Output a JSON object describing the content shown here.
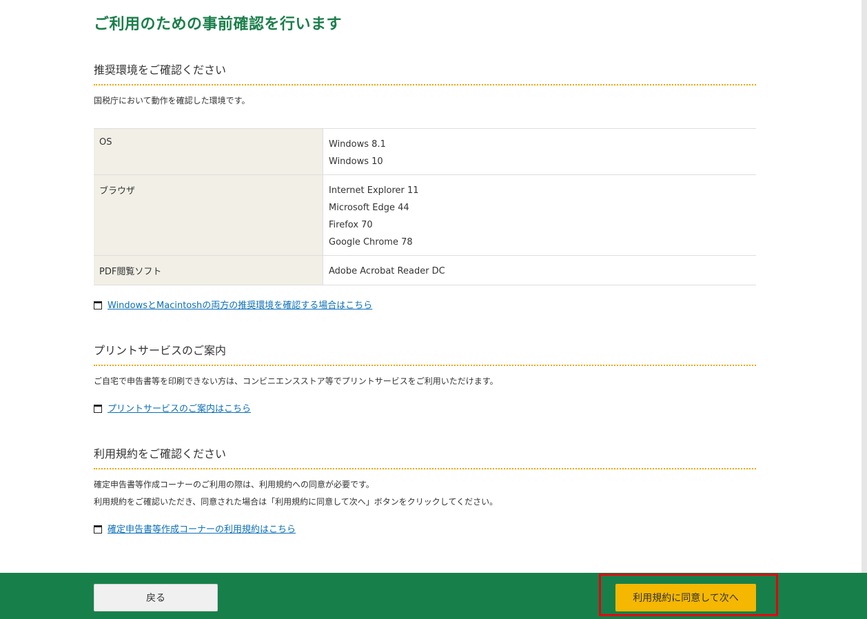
{
  "page_title": "ご利用のための事前確認を行います",
  "env_section": {
    "heading": "推奨環境をご確認ください",
    "description": "国税庁において動作を確認した環境です。",
    "rows": [
      {
        "label": "OS",
        "values": [
          "Windows 8.1",
          "Windows 10"
        ]
      },
      {
        "label": "ブラウザ",
        "values": [
          "Internet Explorer 11",
          "Microsoft Edge 44",
          "Firefox 70",
          "Google Chrome 78"
        ]
      },
      {
        "label": "PDF閲覧ソフト",
        "values": [
          "Adobe Acrobat Reader DC"
        ]
      }
    ],
    "link": "WindowsとMacintoshの両方の推奨環境を確認する場合はこちら"
  },
  "print_section": {
    "heading": "プリントサービスのご案内",
    "description": "ご自宅で申告書等を印刷できない方は、コンビニエンスストア等でプリントサービスをご利用いただけます。",
    "link": "プリントサービスのご案内はこちら"
  },
  "terms_section": {
    "heading": "利用規約をご確認ください",
    "description_line1": "確定申告書等作成コーナーのご利用の際は、利用規約への同意が必要です。",
    "description_line2": "利用規約をご確認いただき、同意された場合は「利用規約に同意して次へ」ボタンをクリックしてください。",
    "link": "確定申告書等作成コーナーの利用規約はこちら"
  },
  "footer": {
    "back_label": "戻る",
    "agree_label": "利用規約に同意して次へ"
  },
  "icons": {
    "new_window": "new-window-icon"
  },
  "colors": {
    "title_green": "#1a7f4a",
    "footer_green": "#17804a",
    "heading_underline": "#f0a500",
    "agree_button": "#f5b700",
    "highlight_border": "#e60012",
    "link_blue": "#0b6fb8",
    "table_header_bg": "#f1efe6"
  }
}
